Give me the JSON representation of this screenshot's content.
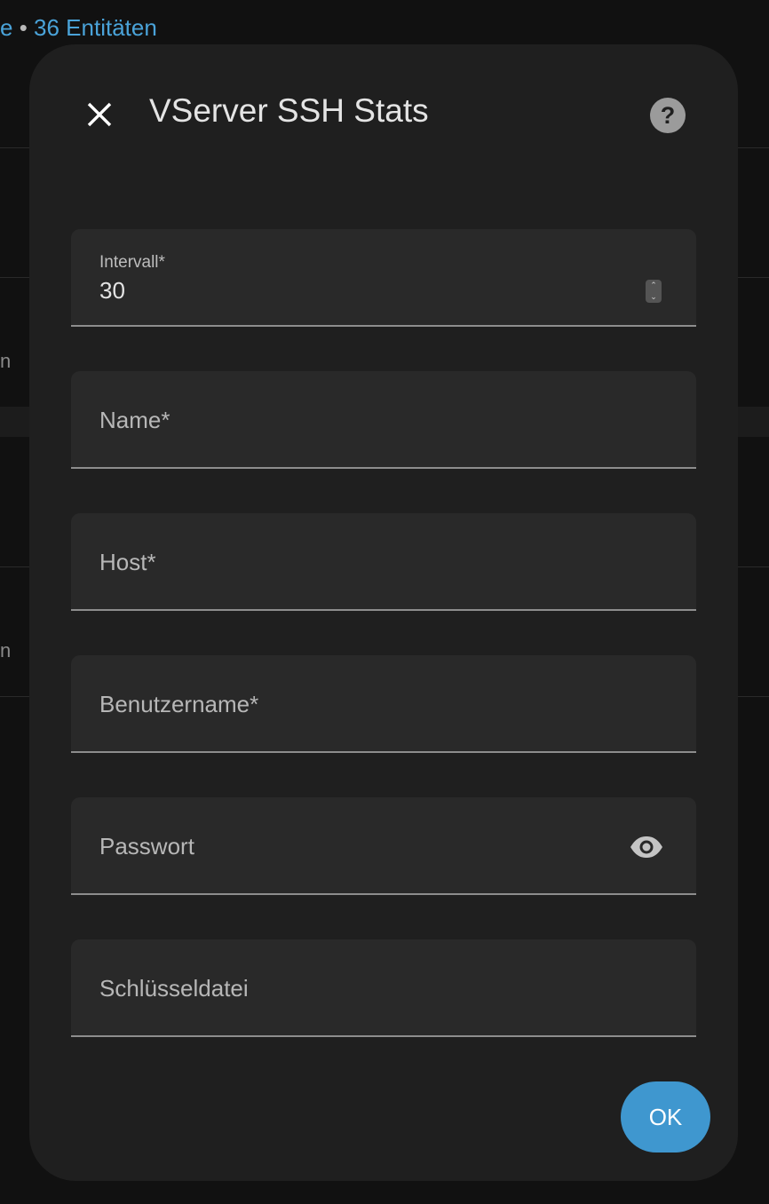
{
  "background": {
    "header_left": "e",
    "header_sep": " • ",
    "header_right": "36 Entitäten",
    "row_fragments": [
      "n",
      "n"
    ]
  },
  "dialog": {
    "title": "VServer SSH Stats",
    "close_icon": "close-icon",
    "help_icon": "help-circle-icon"
  },
  "fields": {
    "interval": {
      "label": "Intervall*",
      "value": "30"
    },
    "name": {
      "placeholder": "Name*"
    },
    "host": {
      "placeholder": "Host*"
    },
    "username": {
      "placeholder": "Benutzername*"
    },
    "password": {
      "placeholder": "Passwort",
      "icon": "eye-icon"
    },
    "keyfile": {
      "placeholder": "Schlüsseldatei"
    }
  },
  "actions": {
    "ok_label": "OK"
  },
  "colors": {
    "accent": "#3f97cf",
    "link": "#4aa3d9",
    "dialog_bg": "#1f1f1f",
    "field_bg": "#292929"
  }
}
